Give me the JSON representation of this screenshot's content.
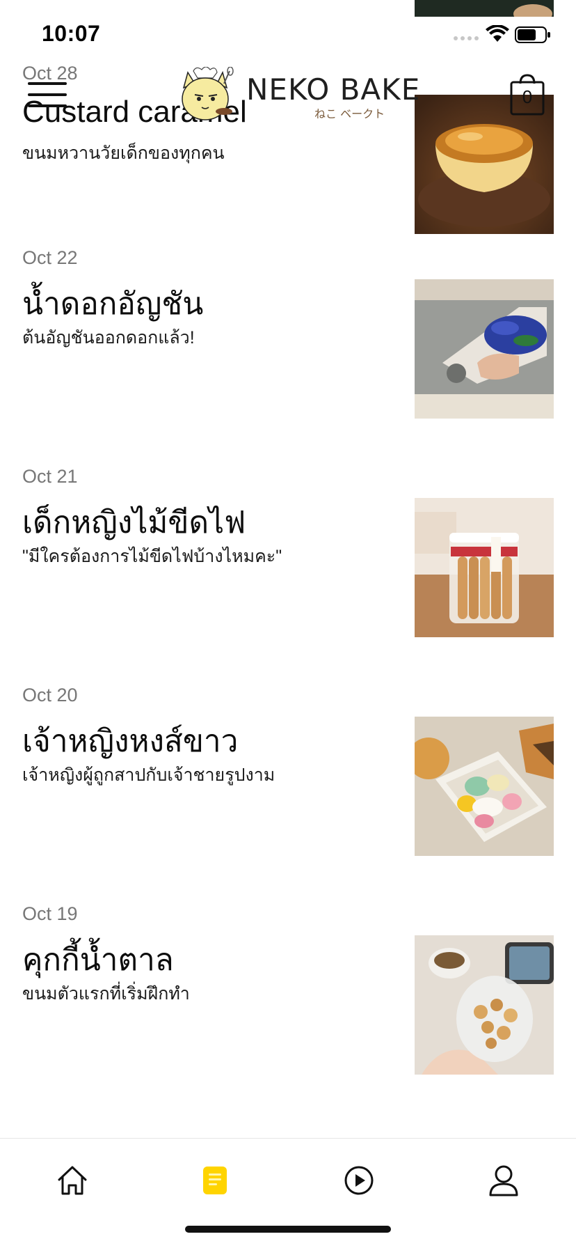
{
  "status_bar": {
    "time": "10:07"
  },
  "header": {
    "logo_text": "NEKO BAKE",
    "logo_subtext": "ねこ ベークト",
    "cart_count": "0",
    "accent_color": "#ffd400"
  },
  "posts": [
    {
      "date": "Oct 28",
      "title": "Custard caramel",
      "subtitle": "ขนมหวานวัยเด็กของทุกคน",
      "image": "custard-caramel-photo"
    },
    {
      "date": "Oct 22",
      "title": "น้ำดอกอัญชัน",
      "subtitle": "ต้นอัญชันออกดอกแล้ว!",
      "image": "butterfly-pea-flowers-photo"
    },
    {
      "date": "Oct 21",
      "title": "เด็กหญิงไม้ขีดไฟ",
      "subtitle": "\"มีใครต้องการไม้ขีดไฟบ้างไหมคะ\"",
      "image": "matchstick-cookies-jar-photo"
    },
    {
      "date": "Oct 20",
      "title": "เจ้าหญิงหงส์ขาว",
      "subtitle": "เจ้าหญิงผู้ถูกสาปกับเจ้าชายรูปงาม",
      "image": "swan-cookies-box-photo"
    },
    {
      "date": "Oct 19",
      "title": "คุกกี้น้ำตาล",
      "subtitle": "ขนมตัวแรกที่เริ่มฝึกทำ",
      "image": "sugar-cookies-jar-photo"
    }
  ],
  "tab_bar": {
    "items": [
      {
        "icon": "home-icon",
        "active": false
      },
      {
        "icon": "document-icon",
        "active": true
      },
      {
        "icon": "play-icon",
        "active": false
      },
      {
        "icon": "profile-icon",
        "active": false
      }
    ]
  }
}
